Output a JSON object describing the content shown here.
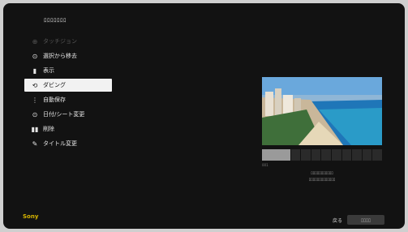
{
  "header": {
    "title": "ﾛﾛﾛﾛﾛﾛﾛ"
  },
  "menu": {
    "items": [
      {
        "icon": "⊕",
        "label": "タッチジョン",
        "state": "dim"
      },
      {
        "icon": "⊙",
        "label": "選択から移去",
        "state": "normal"
      },
      {
        "icon": "▮",
        "label": "表示",
        "state": "normal"
      },
      {
        "icon": "⟲",
        "label": "ダビング",
        "state": "selected"
      },
      {
        "icon": "⋮",
        "label": "自動保存",
        "state": "normal"
      },
      {
        "icon": "⊙",
        "label": "日付/シート変更",
        "state": "normal"
      },
      {
        "icon": "▮▮",
        "label": "削除",
        "state": "normal"
      },
      {
        "icon": "✎",
        "label": "タイトル変更",
        "state": "normal"
      }
    ]
  },
  "preview": {
    "counter": "001",
    "caption_line1": "ﾛﾛﾛﾛﾛﾛﾛﾛﾛﾛﾛ",
    "caption_line2": "ﾛﾛﾛﾛﾛﾛﾛﾛﾛﾛﾛﾛﾛ"
  },
  "brand": {
    "logo_text": "Sony"
  },
  "footer": {
    "key_label": "戻る",
    "button_label": "ﾛﾛﾛﾛ"
  },
  "colors": {
    "selected_bg": "#f2f2f2",
    "logo": "#d9b600",
    "screen_bg": "#121212"
  }
}
